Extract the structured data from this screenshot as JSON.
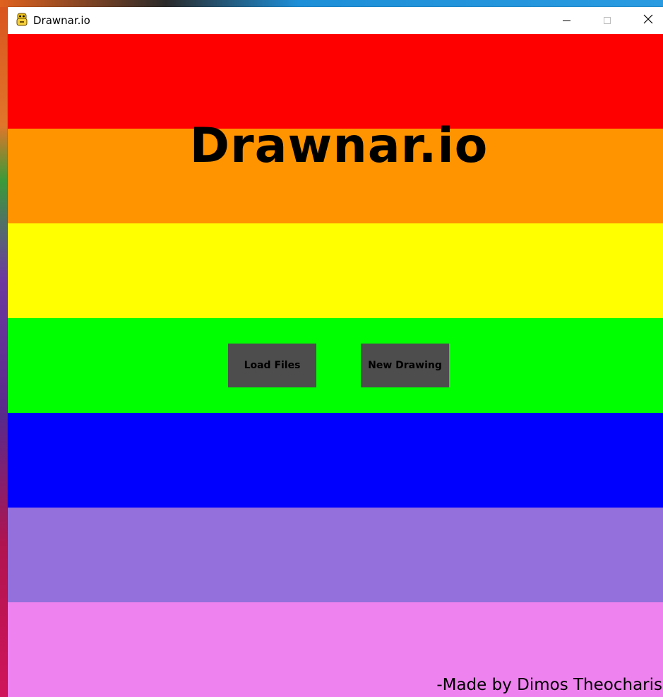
{
  "window": {
    "title": "Drawnar.io",
    "controls": {
      "minimize": "minimize-icon",
      "maximize": "maximize-icon",
      "close": "close-icon"
    }
  },
  "app": {
    "heading": "Drawnar.io",
    "buttons": {
      "load": "Load Files",
      "new": "New Drawing"
    },
    "credit": "-Made by Dimos Theocharis"
  },
  "colors": {
    "stripes": [
      "#ff0000",
      "#ff9400",
      "#ffff00",
      "#00ff00",
      "#0000ff",
      "#9370db",
      "#ee82ee"
    ],
    "button_bg": "#4d4d4d"
  }
}
